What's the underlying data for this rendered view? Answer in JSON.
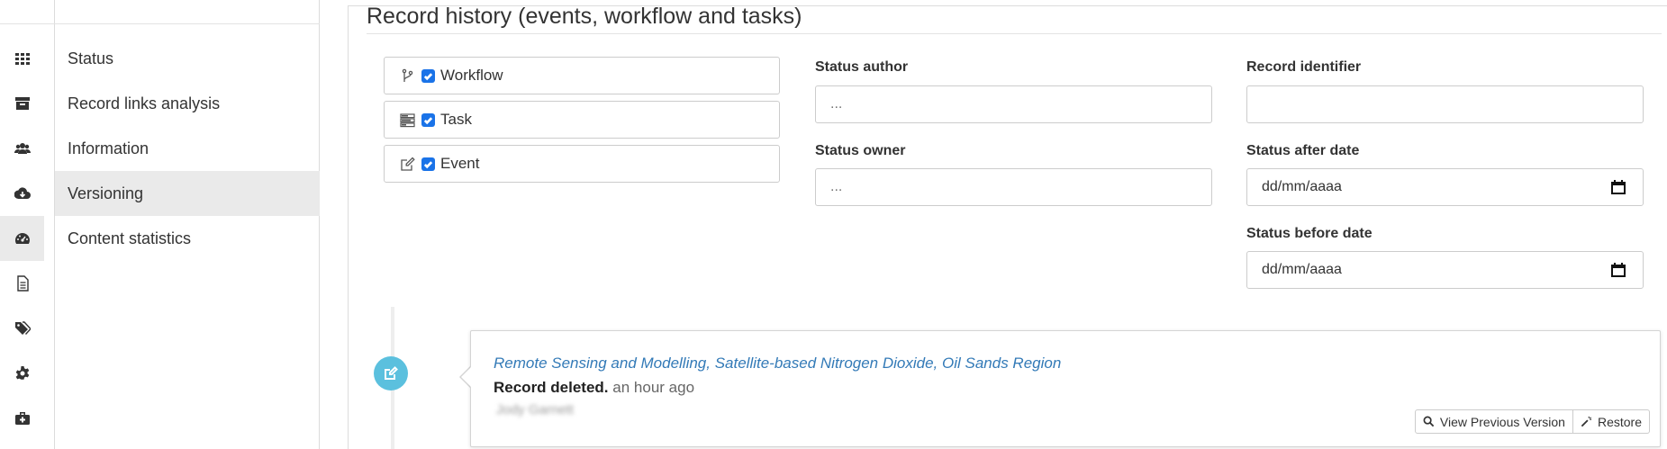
{
  "sidebar_icons": [
    {
      "name": "dashboard-grid-icon",
      "active": false
    },
    {
      "name": "archive-icon",
      "active": false
    },
    {
      "name": "users-icon",
      "active": false
    },
    {
      "name": "cloud-download-icon",
      "active": false
    },
    {
      "name": "dashboard-gauge-icon",
      "active": true
    },
    {
      "name": "document-icon",
      "active": false
    },
    {
      "name": "tags-icon",
      "active": false
    },
    {
      "name": "gear-icon",
      "active": false
    },
    {
      "name": "medkit-icon",
      "active": false
    }
  ],
  "submenu": {
    "items": [
      {
        "label": "Status",
        "active": false
      },
      {
        "label": "Record links analysis",
        "active": false
      },
      {
        "label": "Information",
        "active": false
      },
      {
        "label": "Versioning",
        "active": true
      },
      {
        "label": "Content statistics",
        "active": false
      }
    ]
  },
  "page": {
    "title": "Record history (events, workflow and tasks)"
  },
  "filters": {
    "types": [
      {
        "label": "Workflow",
        "checked": true,
        "icon": "branch-icon"
      },
      {
        "label": "Task",
        "checked": true,
        "icon": "tasks-icon"
      },
      {
        "label": "Event",
        "checked": true,
        "icon": "edit-icon"
      }
    ],
    "status_author": {
      "label": "Status author",
      "placeholder": "..."
    },
    "status_owner": {
      "label": "Status owner",
      "placeholder": "..."
    },
    "record_identifier": {
      "label": "Record identifier",
      "placeholder": ""
    },
    "status_after_date": {
      "label": "Status after date",
      "value": "dd/mm/aaaa"
    },
    "status_before_date": {
      "label": "Status before date",
      "value": "dd/mm/aaaa"
    }
  },
  "timeline": {
    "entries": [
      {
        "record_title": "Remote Sensing and Modelling, Satellite-based Nitrogen Dioxide, Oil Sands Region",
        "action": "Record deleted.",
        "time": "an hour ago",
        "user": "Jody Garnett",
        "view_previous_label": "View Previous Version",
        "restore_label": "Restore"
      }
    ]
  },
  "colors": {
    "accent_checkbox": "#1a73e8",
    "timeline_badge": "#5bc0de",
    "link": "#337ab7",
    "active_bg": "#eaeaea"
  }
}
